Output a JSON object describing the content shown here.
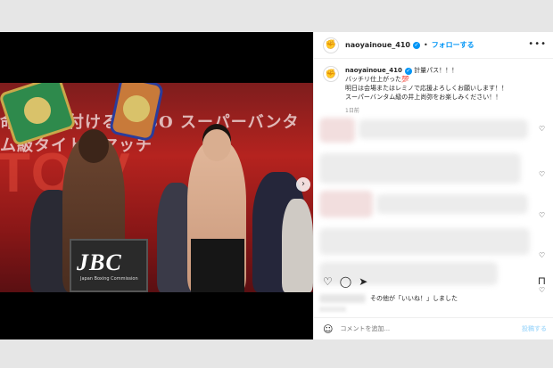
{
  "post": {
    "username": "naoyainoue_410",
    "follow_label": "フォローする",
    "separator": "•",
    "more_label": "•••"
  },
  "media": {
    "banner_text": "命を突き付ける WBO スーパーバンタム級タイトルマッチ",
    "banner_big": "TO  V",
    "podium_logo": "JBC",
    "podium_sub": "Japan Boxing Commission",
    "next_arrow": "›"
  },
  "caption": {
    "username": "naoyainoue_410",
    "lines": [
      "計量パス！！！",
      "バッチリ仕上がった💯",
      "明日は会場またはレミノで応援よろしくお願いします！！",
      "スーパーバンタム級の井上尚弥をお楽しみください！！"
    ],
    "time": "1日前"
  },
  "actions": {
    "like_icon": "heart-icon",
    "comment_icon": "comment-icon",
    "share_icon": "send-icon",
    "save_icon": "bookmark-icon"
  },
  "likes": {
    "text": "その他が「いいね！」しました"
  },
  "comment_box": {
    "placeholder": "コメントを追加...",
    "post_label": "投稿する"
  }
}
